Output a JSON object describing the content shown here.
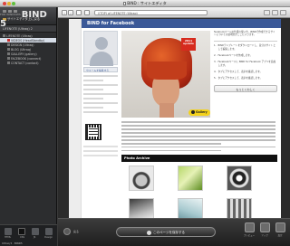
{
  "window": {
    "title": "BIND : サイトエディタ"
  },
  "sidebar": {
    "breadcrumb": "サイトエディタ上に戻る",
    "logo_small": "FOR WINDOWS",
    "logo": "BIND 5",
    "site_label": "LIFENOTE (Ultraq) 2",
    "tree": [
      {
        "label": "LIFENOTE (Ultraq)",
        "selected": false
      },
      {
        "label": "VIDEOS (HeadStandby)",
        "selected": true
      },
      {
        "label": "DESIGN (Ultraq)",
        "selected": false
      },
      {
        "label": "BLOG (Ultraq)",
        "selected": false
      },
      {
        "label": "GALLERY (gallery)",
        "selected": false
      },
      {
        "label": "FACEBOOK (connect)",
        "selected": false
      },
      {
        "label": "CONTACT (contact)",
        "selected": false
      }
    ],
    "tools": [
      "HTML",
      "CSS",
      "JS",
      "Design"
    ],
    "status": "Ultraq 5 · BIND5"
  },
  "toolbar": {
    "back": "‹",
    "forward": "›",
    "url": "/(TOP) of LIFENOTE (Ultraq)"
  },
  "page": {
    "header_title": "BIND for Facebook",
    "profile_link": "ウォールを編集する",
    "badge_line1": "2011",
    "badge_line2": "update",
    "gallery_label": "Gallery",
    "intro": "facebookページの仕様の使い方、BINDで作成できるサイトについての説明文がここに入ります。",
    "steps": [
      {
        "n": "1.",
        "text": "BINDテンプレートをダウンロードし、自分のサイトとして編集します。"
      },
      {
        "n": "2.",
        "text": "Facebookページを作成します。"
      },
      {
        "n": "3.",
        "text": "Facebookページに BIND for Facebook アプリを追加します。"
      },
      {
        "n": "4.",
        "text": "タブにアクセスして、表示を確認します。"
      },
      {
        "n": "5.",
        "text": "タブにアクセスして、表示を確認します。"
      }
    ],
    "more_button": "もっとくわしく",
    "photo_archive": "Photo Archive"
  },
  "bottombar": {
    "left_label": "戻る",
    "publish_button": "このページを保存する",
    "right_items": [
      "プレビュー",
      "アップ",
      "設定"
    ]
  },
  "colors": {
    "facebook_blue": "#3b5998",
    "badge_red": "#d62b1e",
    "gallery_yellow": "#f4d21b"
  }
}
